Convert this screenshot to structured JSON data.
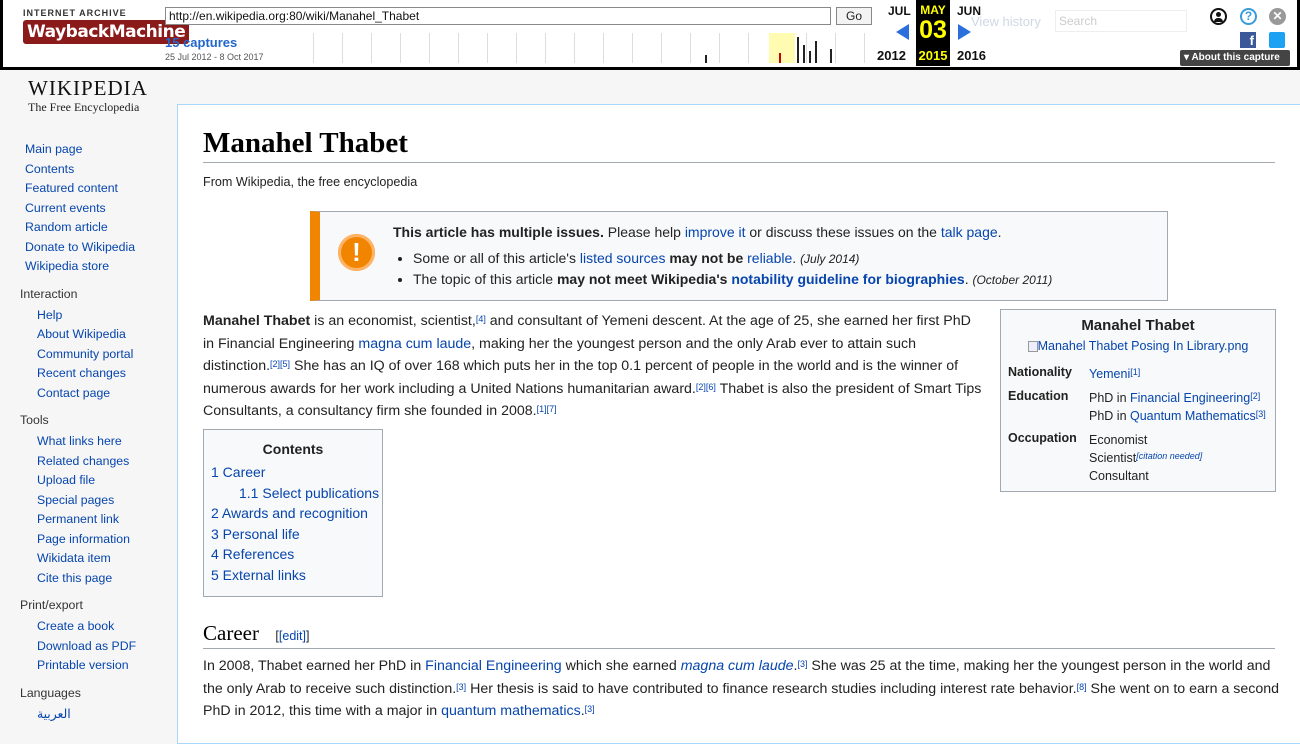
{
  "wayback": {
    "logo_top": "INTERNET ARCHIVE",
    "logo_main": "WaybackMachine",
    "url": "http://en.wikipedia.org:80/wiki/Manahel_Thabet",
    "go": "Go",
    "captures": "15 captures",
    "range": "25 Jul 2012 - 8 Oct 2017",
    "prev_month": "JUL",
    "cur_month": "MAY",
    "next_month": "JUN",
    "prev_year": "2012",
    "cur_day": "03",
    "cur_year": "2015",
    "next_year": "2016",
    "view_history": "View history",
    "search_placeholder": "Search",
    "about": "About this capture"
  },
  "wiki": {
    "logo_name": "WIKIPEDIA",
    "logo_sub": "The Free Encyclopedia"
  },
  "sidebar": {
    "main": [
      "Main page",
      "Contents",
      "Featured content",
      "Current events",
      "Random article",
      "Donate to Wikipedia",
      "Wikipedia store"
    ],
    "interaction_title": "Interaction",
    "interaction": [
      "Help",
      "About Wikipedia",
      "Community portal",
      "Recent changes",
      "Contact page"
    ],
    "tools_title": "Tools",
    "tools": [
      "What links here",
      "Related changes",
      "Upload file",
      "Special pages",
      "Permanent link",
      "Page information",
      "Wikidata item",
      "Cite this page"
    ],
    "print_title": "Print/export",
    "print": [
      "Create a book",
      "Download as PDF",
      "Printable version"
    ],
    "lang_title": "Languages",
    "lang": [
      "العربية"
    ]
  },
  "article": {
    "title": "Manahel Thabet",
    "from": "From Wikipedia, the free encyclopedia",
    "issues": {
      "bold": "This article has multiple issues.",
      "t1": " Please help ",
      "improve": "improve it",
      "t2": " or discuss these issues on the ",
      "talk": "talk page",
      "t3": ".",
      "b1_a": "Some or all of this article's ",
      "b1_link": "listed sources",
      "b1_bold": " may not be ",
      "b1_link2": "reliable",
      "b1_date": "(July 2014)",
      "b2_a": "The topic of this article ",
      "b2_bold": "may not meet Wikipedia's ",
      "b2_link": "notability guideline for biographies",
      "b2_date": "(October 2011)"
    },
    "p1": {
      "name": "Manahel Thabet",
      "s1": " is an economist, scientist,",
      "r4": "[4]",
      "s2": " and consultant of Yemeni descent. At the age of 25, she earned her first PhD in Financial Engineering ",
      "mcl": "magna cum laude",
      "s3": ", making her the youngest person and the only Arab ever to attain such distinction.",
      "r25": "[2][5]",
      "s4": " She has an IQ of over 168 which puts her in the top 0.1 percent of people in the world and is the winner of numerous awards for her work including a United Nations humanitarian award.",
      "r26": "[2][6]",
      "s5": " Thabet is also the president of Smart Tips Consultants, a consultancy firm she founded in 2008.",
      "r17": "[1][7]"
    },
    "infobox": {
      "caption": "Manahel Thabet",
      "image": "Manahel Thabet Posing In Library.png",
      "nat_k": "Nationality",
      "nat_v": "Yemeni",
      "nat_r": "[1]",
      "edu_k": "Education",
      "edu_1a": "PhD in ",
      "edu_1b": "Financial Engineering",
      "edu_1r": "[2]",
      "edu_2a": "PhD in ",
      "edu_2b": "Quantum Mathematics",
      "edu_2r": "[3]",
      "occ_k": "Occupation",
      "occ_1": "Economist",
      "occ_2": "Scientist",
      "occ_2r": "[citation needed]",
      "occ_3": "Consultant"
    },
    "toc": {
      "title": "Contents",
      "entries": [
        "1 Career",
        "1.1 Select publications",
        "2 Awards and recognition",
        "3 Personal life",
        "4 References",
        "5 External links"
      ]
    },
    "career": {
      "heading": "Career",
      "edit": "[edit]",
      "a": "In 2008, Thabet earned her PhD in ",
      "fe": "Financial Engineering",
      "b": " which she earned ",
      "mcl": "magna cum laude",
      "c": ".",
      "r3": "[3]",
      "d": " She was 25 at the time, making her the youngest person in the world and the only Arab to receive such distinction.",
      "r3b": "[3]",
      "e": " Her thesis is said to have contributed to finance research studies including interest rate behavior.",
      "r8": "[8]",
      "f": " She went on to earn a second PhD in 2012, this time with a major in ",
      "qm": "quantum mathematics",
      "g": ".",
      "r3c": "[3]"
    }
  }
}
